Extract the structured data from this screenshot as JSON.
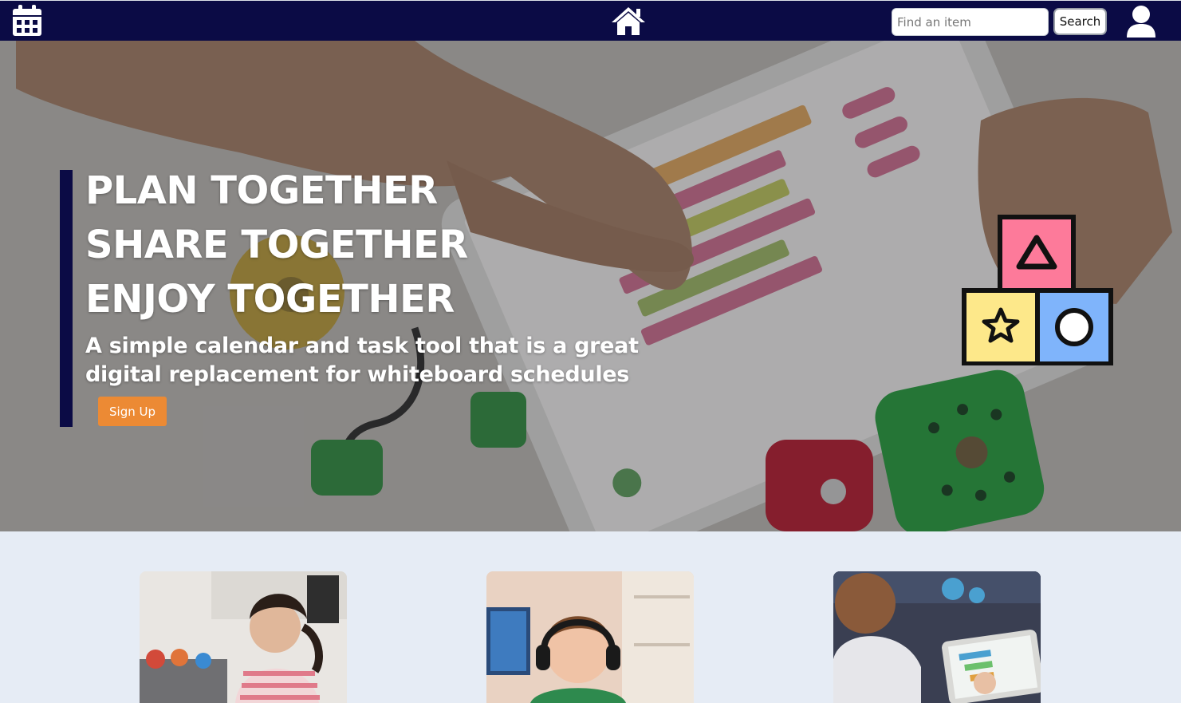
{
  "navbar": {
    "calendar_icon": "calendar-icon",
    "home_icon": "home-icon",
    "search": {
      "placeholder": "Find an item",
      "value": ""
    },
    "search_button_label": "Search",
    "user_icon": "user-icon"
  },
  "hero": {
    "lines": [
      "PLAN TOGETHER",
      "SHARE TOGETHER",
      "ENJOY TOGETHER"
    ],
    "subtitle": "A simple calendar and task tool that is a great digital replacement for whiteboard schedules",
    "signup_label": "Sign Up",
    "logo_icon": "toy-blocks-icon"
  },
  "cards": [
    {
      "name": "card-girl-playing",
      "icon": "photo-girl-playing"
    },
    {
      "name": "card-boy-headphones",
      "icon": "photo-boy-headphones"
    },
    {
      "name": "card-boy-tablet",
      "icon": "photo-boy-tablet"
    }
  ],
  "colors": {
    "navbar": "#0b0b45",
    "accent": "#ec8a34",
    "page_background": "#e6ecf5",
    "block_pink": "#fd7a9a",
    "block_yellow": "#fde88a",
    "block_blue": "#7fb4fb"
  }
}
